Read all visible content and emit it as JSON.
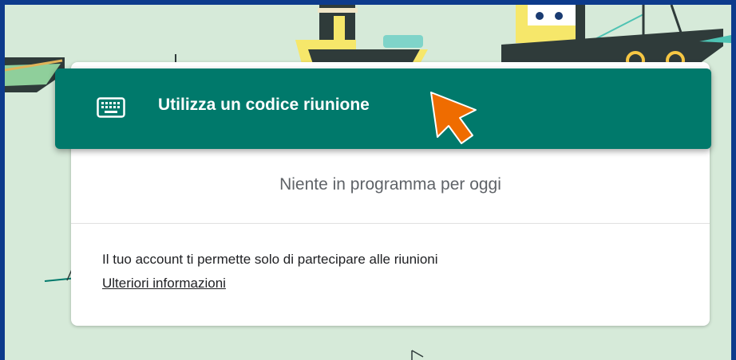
{
  "join_button": {
    "label": "Utilizza un codice riunione",
    "icon": "keyboard-icon"
  },
  "meetings": {
    "empty_message": "Niente in programma per oggi"
  },
  "account": {
    "note": "Il tuo account ti permette solo di partecipare alle riunioni",
    "link_label": "Ulteriori informazioni"
  },
  "colors": {
    "accent": "#00796b",
    "background": "#d6ead9",
    "frame": "#0d3b8c",
    "pointer": "#ef6c00"
  }
}
